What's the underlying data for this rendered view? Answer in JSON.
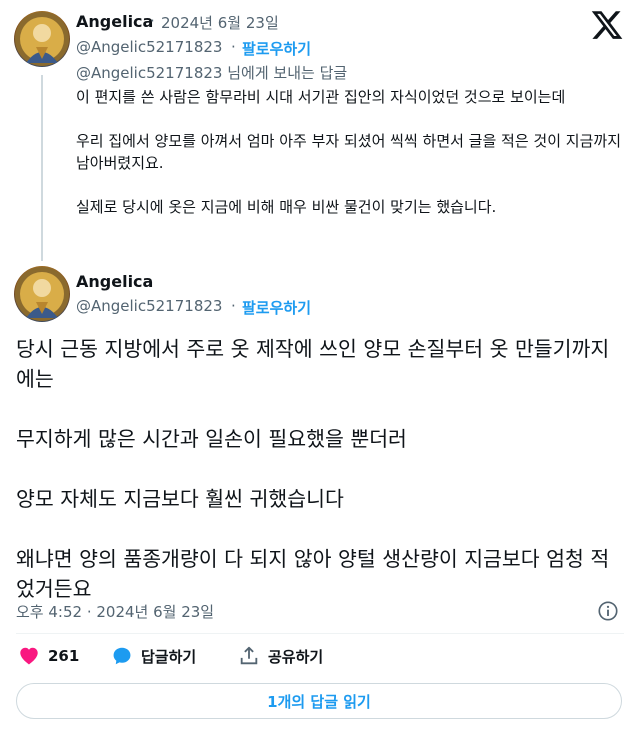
{
  "reply_tweet": {
    "author_name": "Angelica",
    "timestamp": "2024년 6월 23일",
    "handle": "@Angelic52171823",
    "follow_label": "팔로우하기",
    "replying_to_handle": "@Angelic52171823",
    "replying_to_suffix": "님에게 보내는 답글",
    "paragraphs": [
      "이 편지를 쓴 사람은 함무라비 시대 서기관 집안의 자식이었던 것으로 보이는데",
      "우리 집에서 양모를 아껴서 엄마 아주 부자 되셨어 씩씩 하면서 글을 적은 것이 지금까지 남아버렸지요.",
      "실제로 당시에 옷은 지금에 비해 매우 비싼 물건이 맞기는 했습니다."
    ]
  },
  "main_tweet": {
    "author_name": "Angelica",
    "handle": "@Angelic52171823",
    "follow_label": "팔로우하기",
    "paragraphs": [
      "당시 근동 지방에서 주로 옷 제작에 쓰인 양모 손질부터 옷 만들기까지에는",
      "무지하게 많은 시간과 일손이 필요했을 뿐더러",
      "양모 자체도 지금보다 훨씬 귀했습니다",
      "왜냐면 양의 품종개량이 다 되지 않아 양털 생산량이 지금보다 엄청 적었거든요"
    ],
    "timestamp": "오후 4:52 · 2024년 6월 23일"
  },
  "actions": {
    "like_count": "261",
    "reply_label": "답글하기",
    "share_label": "공유하기"
  },
  "read_replies_label": "1개의 답글 읽기",
  "separator": "·",
  "icons": {
    "logo": "x-logo-icon",
    "like": "heart-icon",
    "reply": "reply-bubble-icon",
    "share": "share-icon",
    "info": "info-icon"
  },
  "colors": {
    "accent": "#1d9bf0",
    "like": "#f91880",
    "secondary_text": "#536471",
    "primary_text": "#0f1419"
  }
}
